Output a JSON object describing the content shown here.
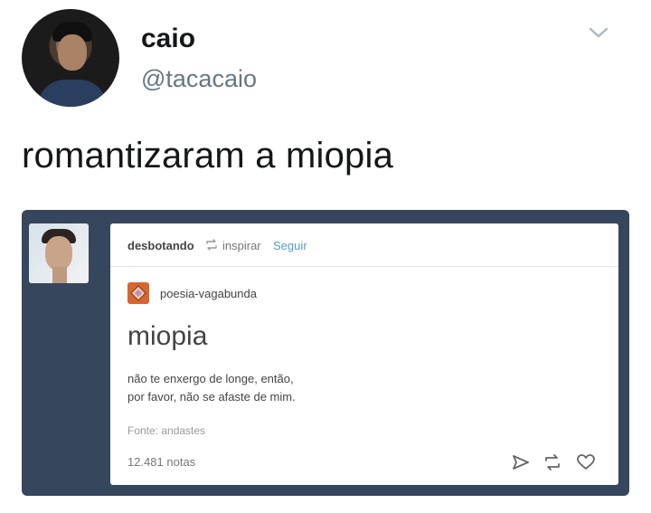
{
  "tweet": {
    "author_name": "caio",
    "author_handle": "@tacacaio",
    "text": "romantizaram a miopia",
    "menu_icon": "chevron-down-icon"
  },
  "embedded_post": {
    "reblogger": "desbotando",
    "reblog_icon": "reblog-icon",
    "reblog_text": "inspirar",
    "follow_label": "Seguir",
    "source_blog": "poesia-vagabunda",
    "title": "miopia",
    "body_lines": [
      "não te enxergo de longe, então,",
      "por favor, não se afaste de mim."
    ],
    "source_credit": "Fonte: andastes",
    "notes_count": "12.481 notas",
    "actions": [
      "share-icon",
      "reblog-icon",
      "heart-icon"
    ],
    "colors": {
      "dashboard_bg": "#36465d",
      "link": "#529ecc",
      "source_avatar": "#d9652f"
    }
  }
}
